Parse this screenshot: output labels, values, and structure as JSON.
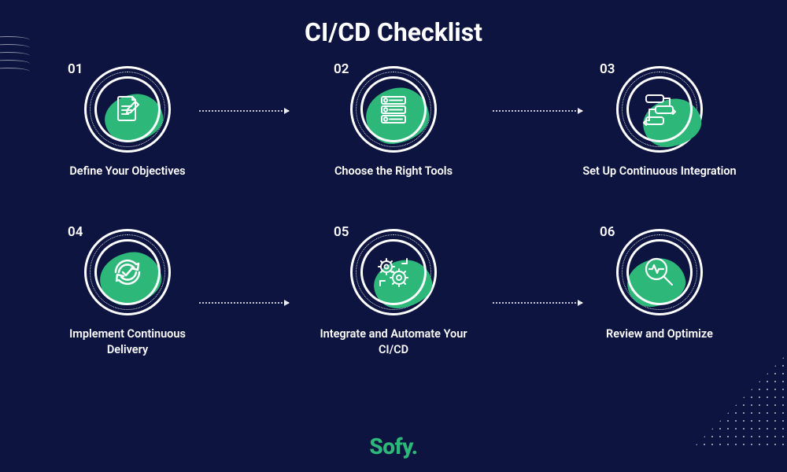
{
  "title": "CI/CD Checklist",
  "brand": "Sofy.",
  "colors": {
    "background": "#0d1440",
    "foreground": "#ffffff",
    "accent": "#2db87a"
  },
  "steps": [
    {
      "num": "01",
      "label": "Define Your Objectives",
      "icon": "document-pencil-icon"
    },
    {
      "num": "02",
      "label": "Choose the Right Tools",
      "icon": "numbered-list-icon"
    },
    {
      "num": "03",
      "label": "Set Up Continuous Integration",
      "icon": "pipeline-flow-icon"
    },
    {
      "num": "04",
      "label": "Implement Continuous Delivery",
      "icon": "cycle-check-icon"
    },
    {
      "num": "05",
      "label": "Integrate and Automate Your CI/CD",
      "icon": "gears-loop-icon"
    },
    {
      "num": "06",
      "label": "Review and Optimize",
      "icon": "magnifier-pulse-icon"
    }
  ]
}
